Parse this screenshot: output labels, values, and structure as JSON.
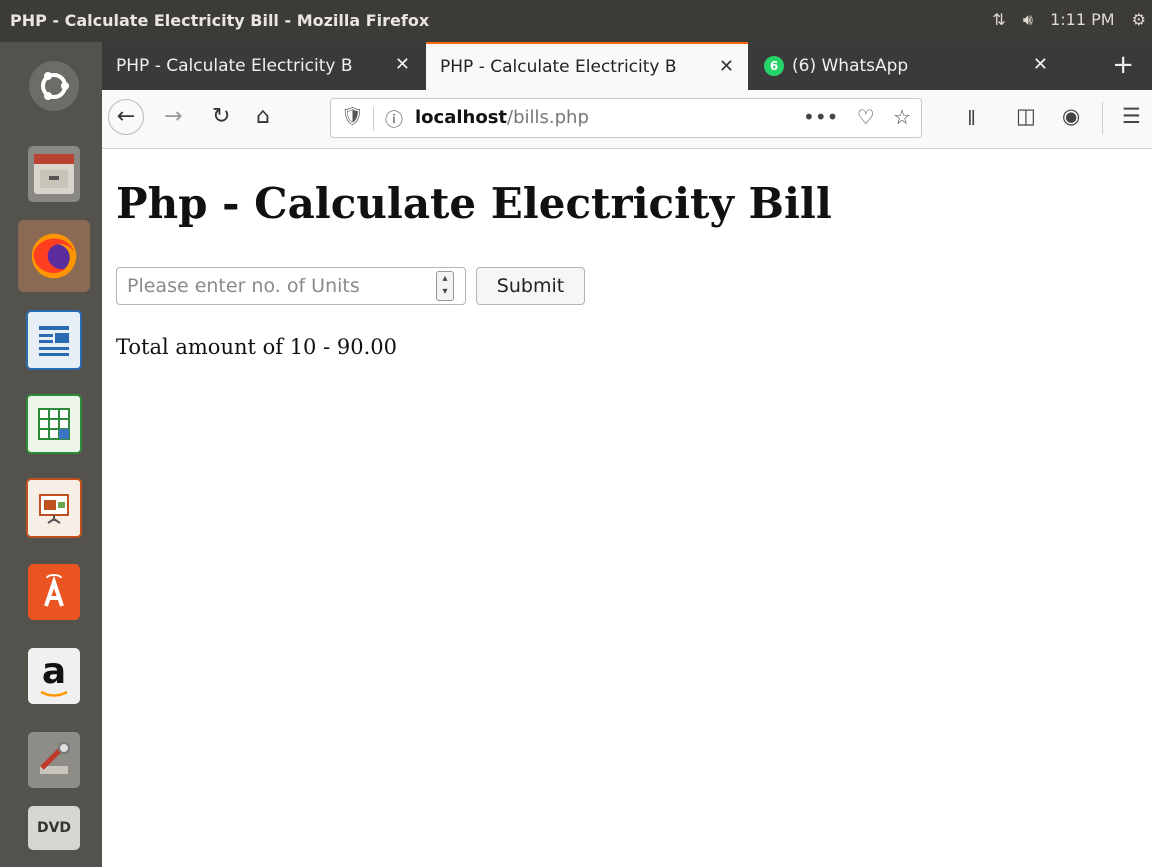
{
  "window": {
    "title": "PHP - Calculate Electricity Bill - Mozilla Firefox",
    "tray": {
      "clock": "1:11 PM"
    }
  },
  "tabs": [
    {
      "label": "PHP - Calculate Electricity B",
      "active": false
    },
    {
      "label": "PHP - Calculate Electricity B",
      "active": true
    },
    {
      "label": "(6) WhatsApp",
      "badge": "6",
      "active": false
    }
  ],
  "address_bar": {
    "host": "localhost",
    "path": "/bills.php"
  },
  "launcher": {
    "items": [
      "ubuntu-dash-icon",
      "files-icon",
      "firefox-icon",
      "writer-icon",
      "calc-icon",
      "impress-icon",
      "software-center-icon",
      "amazon-icon",
      "settings-icon",
      "dvd-icon"
    ],
    "amazon_glyph": "a",
    "dvd_label": "DVD"
  },
  "page": {
    "heading": "Php - Calculate Electricity Bill",
    "units_placeholder": "Please enter no. of Units",
    "submit_label": "Submit",
    "result_text": "Total amount of 10 - 90.00"
  },
  "colors": {
    "tab_accent": "#ff6611",
    "whatsapp_green": "#25d366",
    "launcher_bg": "#54524d",
    "topbar_bg": "#3c3b37"
  }
}
